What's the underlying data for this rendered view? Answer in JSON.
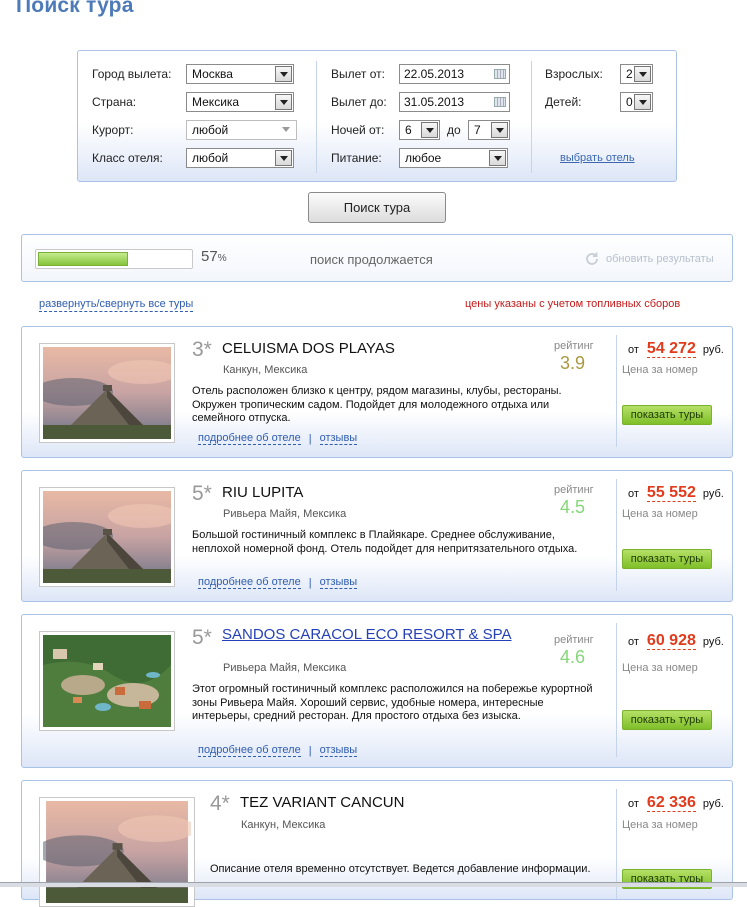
{
  "page": {
    "title": "Поиск тура"
  },
  "form": {
    "departure_city": {
      "label": "Город вылета:",
      "value": "Москва"
    },
    "country": {
      "label": "Страна:",
      "value": "Мексика"
    },
    "resort": {
      "label": "Курорт:",
      "value": "любой"
    },
    "hotel_class": {
      "label": "Класс отеля:",
      "value": "любой"
    },
    "depart_from": {
      "label": "Вылет от:",
      "value": "22.05.2013"
    },
    "depart_to": {
      "label": "Вылет до:",
      "value": "31.05.2013"
    },
    "nights": {
      "label": "Ночей от:",
      "from": "6",
      "to_label": "до",
      "to": "7"
    },
    "meal": {
      "label": "Питание:",
      "value": "любое"
    },
    "adults": {
      "label": "Взрослых:",
      "value": "2"
    },
    "children": {
      "label": "Детей:",
      "value": "0"
    },
    "choose_hotel_link": "выбрать отель",
    "search_button": "Поиск тура"
  },
  "progress": {
    "percent": 57,
    "percent_label": "57",
    "percent_sign": "%",
    "status": "поиск продолжается",
    "refresh_label": "обновить результаты"
  },
  "results": {
    "expand_link": "развернуть/свернуть все туры",
    "fuel_note": "цены указаны с учетом топливных сборов"
  },
  "hotels": [
    {
      "stars": "3*",
      "name": "CELUISMA DOS PLAYAS",
      "location": "Канкун, Мексика",
      "description": "Отель расположен близко к центру, рядом магазины, клубы, рестораны. Окружен тропическим садом. Подойдет для молодежного отдыха или семейного отпуска.",
      "more_link": "подробнее об отеле",
      "reviews_link": "отзывы",
      "rating_label": "рейтинг",
      "rating": "3.9",
      "rating_color": "#a89a42",
      "price_from": "от",
      "price": "54 272",
      "currency": "руб.",
      "price_note": "Цена за номер",
      "show_button": "показать туры",
      "image": "pyramid"
    },
    {
      "stars": "5*",
      "name": "RIU LUPITA",
      "location": "Ривьера Майя, Мексика",
      "description": "Большой гостиничный комплекс в Плайякаре. Среднее обслуживание, неплохой номерной фонд. Отель подойдет для непритязательного отдыха.",
      "more_link": "подробнее об отеле",
      "reviews_link": "отзывы",
      "rating_label": "рейтинг",
      "rating": "4.5",
      "rating_color": "#86d67a",
      "price_from": "от",
      "price": "55 552",
      "currency": "руб.",
      "price_note": "Цена за номер",
      "show_button": "показать туры",
      "image": "pyramid"
    },
    {
      "stars": "5*",
      "name": "SANDOS CARACOL ECO RESORT & SPA",
      "location": "Ривьера Майя, Мексика",
      "description": "Этот огромный гостиничный комплекс расположился на побережье курортной зоны Ривьера Майя. Хороший сервис, удобные номера, интересные интерьеры, средний ресторан. Для простого отдыха без изыска.",
      "more_link": "подробнее об отеле",
      "reviews_link": "отзывы",
      "rating_label": "рейтинг",
      "rating": "4.6",
      "rating_color": "#86d67a",
      "price_from": "от",
      "price": "60 928",
      "currency": "руб.",
      "price_note": "Цена за номер",
      "show_button": "показать туры",
      "image": "resort"
    },
    {
      "stars": "4*",
      "name": "TEZ VARIANT CANCUN",
      "location": "Канкун, Мексика",
      "description": "Описание отеля временно отсутствует. Ведется добавление информации.",
      "price_from": "от",
      "price": "62 336",
      "currency": "руб.",
      "price_note": "Цена за номер",
      "show_button": "показать туры",
      "image": "pyramid"
    }
  ]
}
